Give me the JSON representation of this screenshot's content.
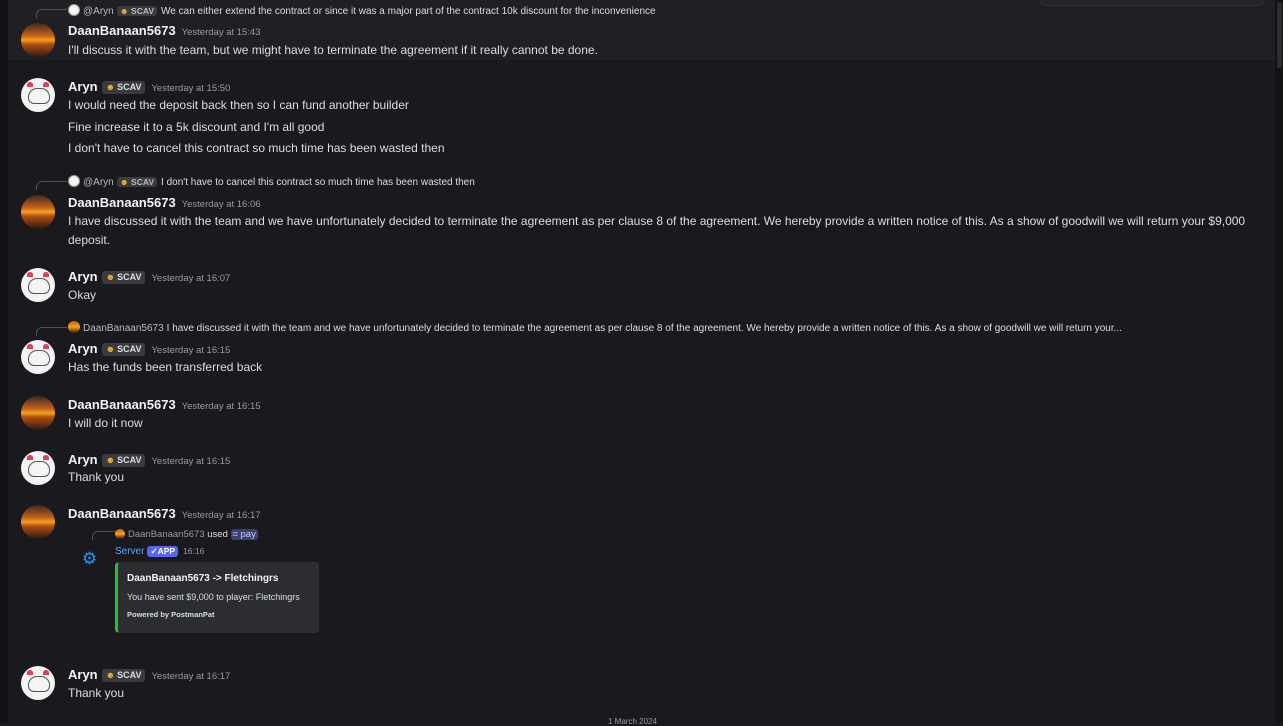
{
  "messages": {
    "m1": {
      "reply": {
        "mention": "@Aryn",
        "tag": "SCAV",
        "text": "We can either extend the contract or since it was a major part of the contract 10k discount for the inconvenience"
      },
      "author": "DaanBanaan5673",
      "time": "Yesterday at 15:43",
      "lines": [
        "I'll discuss it with the team, but we might have to terminate the agreement if it really cannot be done."
      ]
    },
    "m2": {
      "author": "Aryn",
      "tag": "SCAV",
      "time": "Yesterday at 15:50",
      "lines": [
        "I would need the deposit back then so I can fund another builder",
        "Fine increase it to a 5k discount and I'm all good",
        "I don't have to cancel this contract so much time has been wasted then"
      ]
    },
    "m3": {
      "reply": {
        "mention": "@Aryn",
        "tag": "SCAV",
        "text": "I don't have to cancel this contract so much time has been wasted then"
      },
      "author": "DaanBanaan5673",
      "time": "Yesterday at 16:06",
      "lines": [
        "I have discussed it with the team and we have unfortunately decided to terminate the agreement as per clause 8 of the agreement. We hereby provide a written notice of this. As a show of goodwill we will return your $9,000 deposit."
      ]
    },
    "m4": {
      "author": "Aryn",
      "tag": "SCAV",
      "time": "Yesterday at 16:07",
      "lines": [
        "Okay"
      ]
    },
    "m5": {
      "reply": {
        "mention": "DaanBanaan5673",
        "text": "I have discussed it with the team and we have unfortunately decided to terminate the agreement as per clause 8 of the agreement. We hereby provide a written notice of this. As a show of goodwill we will return your..."
      },
      "author": "Aryn",
      "tag": "SCAV",
      "time": "Yesterday at 16:15",
      "lines": [
        "Has the funds been transferred back"
      ]
    },
    "m6": {
      "author": "DaanBanaan5673",
      "time": "Yesterday at 16:15",
      "lines": [
        "I will do it now"
      ]
    },
    "m7": {
      "author": "Aryn",
      "tag": "SCAV",
      "time": "Yesterday at 16:15",
      "lines": [
        "Thank you"
      ]
    },
    "m8": {
      "author": "DaanBanaan5673",
      "time": "Yesterday at 16:17",
      "command": {
        "user": "DaanBanaan5673",
        "used": "used",
        "name": "pay"
      },
      "bot": {
        "name": "Server",
        "badge": "APP",
        "time": "16:16"
      },
      "embed": {
        "title": "DaanBanaan5673 -> Fletchingrs",
        "description": "You have sent $9,000 to player: Fletchingrs",
        "footer": "Powered by PostmanPat",
        "color": "#23c42a"
      }
    },
    "m9": {
      "author": "Aryn",
      "tag": "SCAV",
      "time": "Yesterday at 16:17",
      "lines": [
        "Thank you"
      ]
    }
  },
  "divider": "1 March 2024",
  "colors": {
    "background": "#1a1a1e",
    "text": "#dbdee1",
    "timestamp": "#949ba4",
    "link": "#5ca8f5",
    "app_badge": "#5865f2"
  }
}
